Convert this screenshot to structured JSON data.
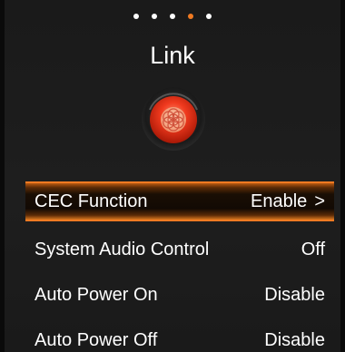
{
  "page": {
    "title": "Link"
  },
  "pager": {
    "count": 5,
    "active_index": 3
  },
  "icons": {
    "link": "link-icon"
  },
  "colors": {
    "accent": "#f07a22",
    "background": "#1e1e1e",
    "text": "#ffffff"
  },
  "menu": {
    "items": [
      {
        "label": "CEC Function",
        "value": "Enable",
        "has_chevron": true,
        "selected": true
      },
      {
        "label": "System Audio Control",
        "value": "Off",
        "has_chevron": false,
        "selected": false
      },
      {
        "label": "Auto Power On",
        "value": "Disable",
        "has_chevron": false,
        "selected": false
      },
      {
        "label": "Auto Power Off",
        "value": "Disable",
        "has_chevron": false,
        "selected": false
      }
    ],
    "chevron": ">"
  }
}
